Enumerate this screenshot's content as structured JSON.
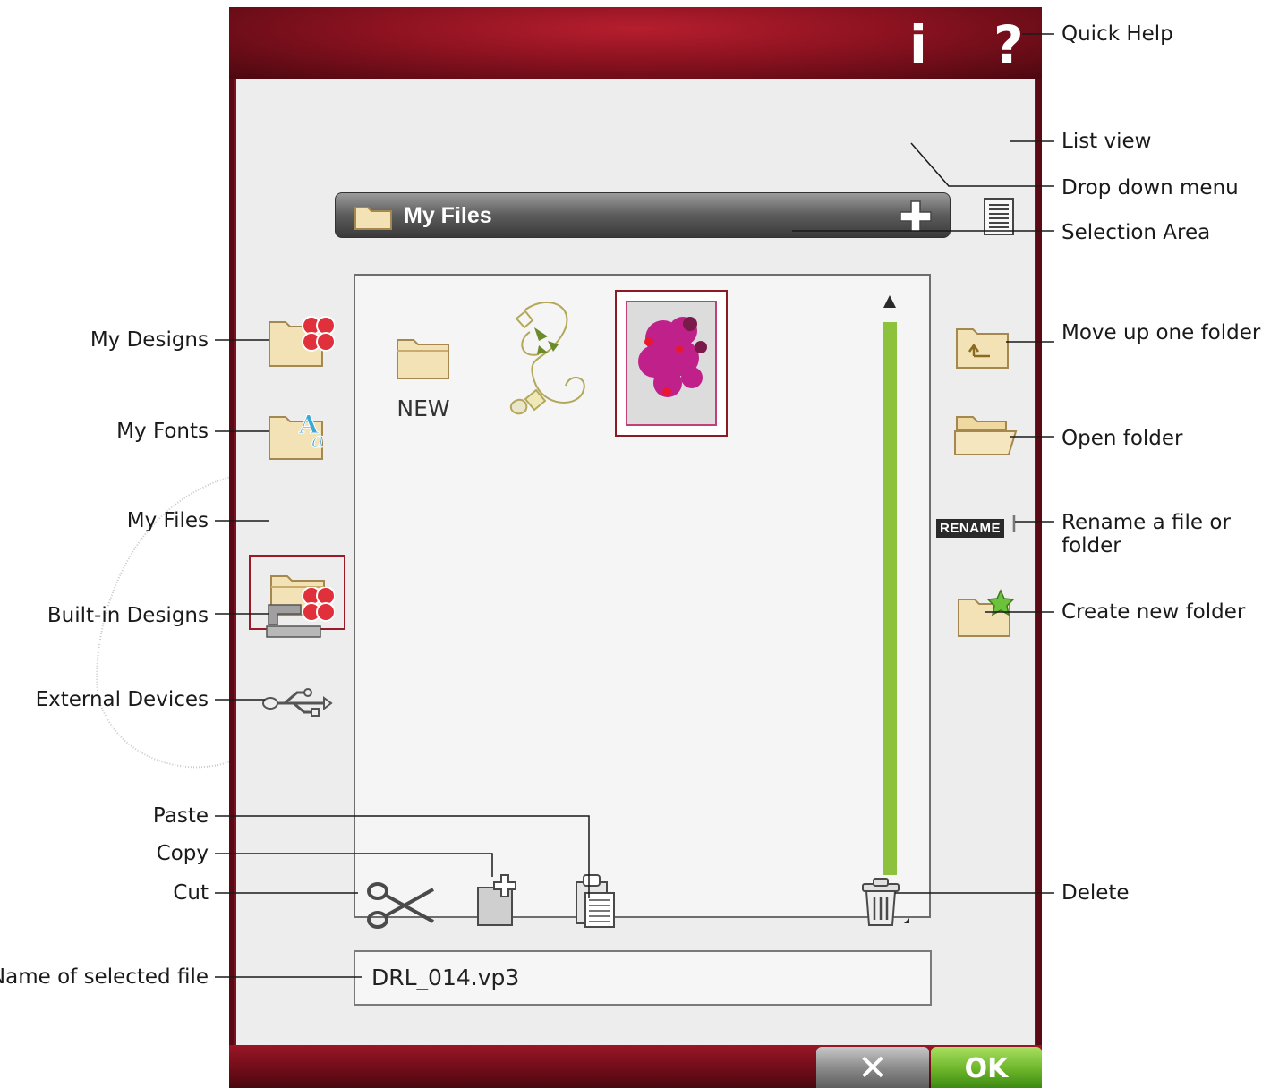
{
  "annotations": {
    "quick_help": "Quick Help",
    "list_view": "List view",
    "drop_down_menu": "Drop down menu",
    "selection_area": "Selection Area",
    "move_up": "Move up one folder",
    "open_folder": "Open folder",
    "rename_line1": "Rename a file or",
    "rename_line2": "folder",
    "create_folder": "Create new folder",
    "delete": "Delete",
    "my_designs": "My Designs",
    "my_fonts": "My Fonts",
    "my_files": "My Files",
    "built_in": "Built-in Designs",
    "external": "External Devices",
    "paste": "Paste",
    "copy": "Copy",
    "cut": "Cut",
    "name_selected": "Name of selected file"
  },
  "topbar": {
    "info_glyph": "i",
    "help_glyph": "?"
  },
  "dropdown": {
    "label": "My Files"
  },
  "selection": {
    "new_label": "NEW"
  },
  "name_field": {
    "value": "DRL_014.vp3"
  },
  "rename_badge": "RENAME",
  "bottom": {
    "cancel_glyph": "✕",
    "ok_label": "OK"
  },
  "icons": {
    "my_designs": "my-designs-folder-icon",
    "my_fonts": "my-fonts-folder-icon",
    "my_files": "my-files-folder-icon",
    "built_in": "built-in-designs-icon",
    "external": "usb-icon",
    "move_up": "folder-up-icon",
    "open_folder": "open-folder-icon",
    "create_folder": "new-folder-star-icon",
    "cut": "scissors-icon",
    "copy": "copy-icon",
    "paste": "clipboard-icon",
    "delete": "trash-icon"
  },
  "colors": {
    "frame_red": "#8c1220",
    "scroll_green": "#8dc23c",
    "ok_green": "#6cb52a",
    "folder_tan": "#f0dca8"
  }
}
